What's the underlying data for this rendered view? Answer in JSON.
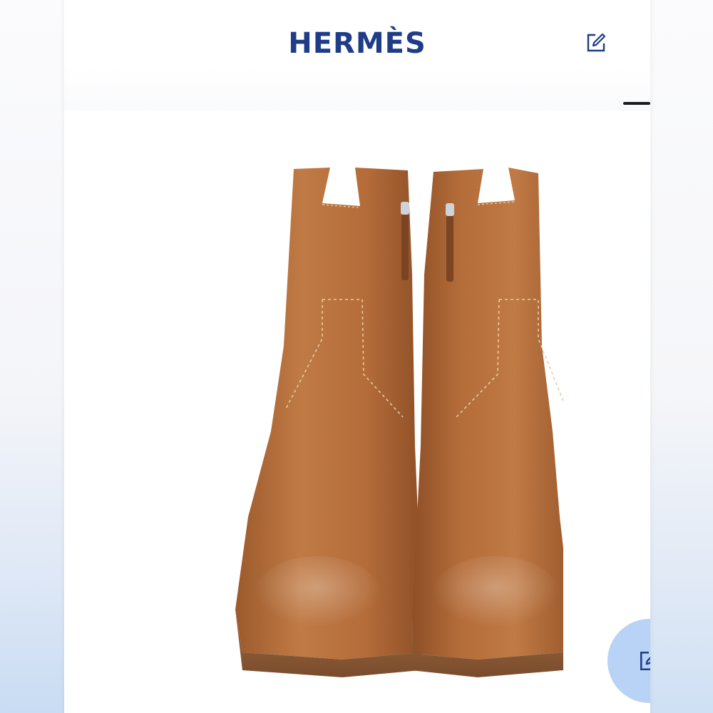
{
  "header": {
    "brand_name": "HERMÈS",
    "edit_icon": "edit-square-icon"
  },
  "product": {
    "image_alt_icon": "ankle-boots-image",
    "leather_color": "#b9703d",
    "sole_color": "#8f5a34"
  },
  "fab": {
    "icon": "edit-square-icon",
    "color": "#b9d3f6"
  },
  "theme": {
    "brand_color": "#1f3c88"
  }
}
